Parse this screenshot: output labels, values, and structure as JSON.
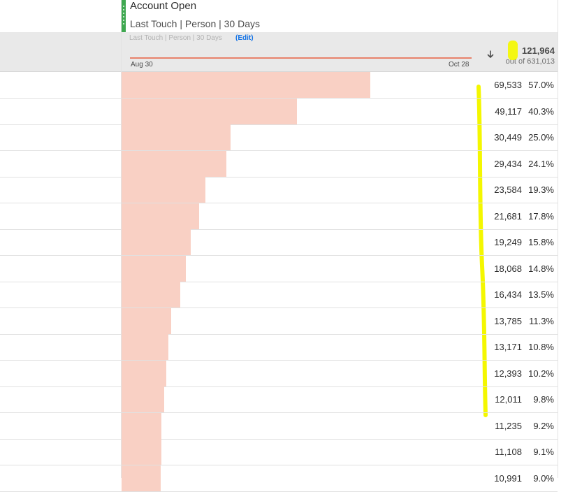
{
  "metric": {
    "title": "Account Open",
    "subtitle": "Last Touch | Person | 30 Days"
  },
  "band": {
    "model_label": "Last Touch | Person | 30 Days",
    "edit_label": "(Edit)",
    "date_start": "Aug 30",
    "date_end": "Oct 28",
    "total_value": "121,964",
    "total_of": "out of 631,013"
  },
  "colors": {
    "accent_handle": "#3fa850",
    "bar_fill": "#f9d0c4",
    "sparkline": "#e8826b",
    "link": "#1473e6",
    "highlight": "#f4f700"
  },
  "icons": {
    "sort": "arrow-down-icon",
    "handle": "drag-handle-icon"
  },
  "rows": [
    {
      "value": "69,533",
      "pct": "57.0%",
      "share": 0.57
    },
    {
      "value": "49,117",
      "pct": "40.3%",
      "share": 0.403
    },
    {
      "value": "30,449",
      "pct": "25.0%",
      "share": 0.25
    },
    {
      "value": "29,434",
      "pct": "24.1%",
      "share": 0.241
    },
    {
      "value": "23,584",
      "pct": "19.3%",
      "share": 0.193
    },
    {
      "value": "21,681",
      "pct": "17.8%",
      "share": 0.178
    },
    {
      "value": "19,249",
      "pct": "15.8%",
      "share": 0.158
    },
    {
      "value": "18,068",
      "pct": "14.8%",
      "share": 0.148
    },
    {
      "value": "16,434",
      "pct": "13.5%",
      "share": 0.135
    },
    {
      "value": "13,785",
      "pct": "11.3%",
      "share": 0.113
    },
    {
      "value": "13,171",
      "pct": "10.8%",
      "share": 0.108
    },
    {
      "value": "12,393",
      "pct": "10.2%",
      "share": 0.102
    },
    {
      "value": "12,011",
      "pct": "9.8%",
      "share": 0.098
    },
    {
      "value": "11,235",
      "pct": "9.2%",
      "share": 0.092
    },
    {
      "value": "11,108",
      "pct": "9.1%",
      "share": 0.091
    },
    {
      "value": "10,991",
      "pct": "9.0%",
      "share": 0.09
    }
  ]
}
